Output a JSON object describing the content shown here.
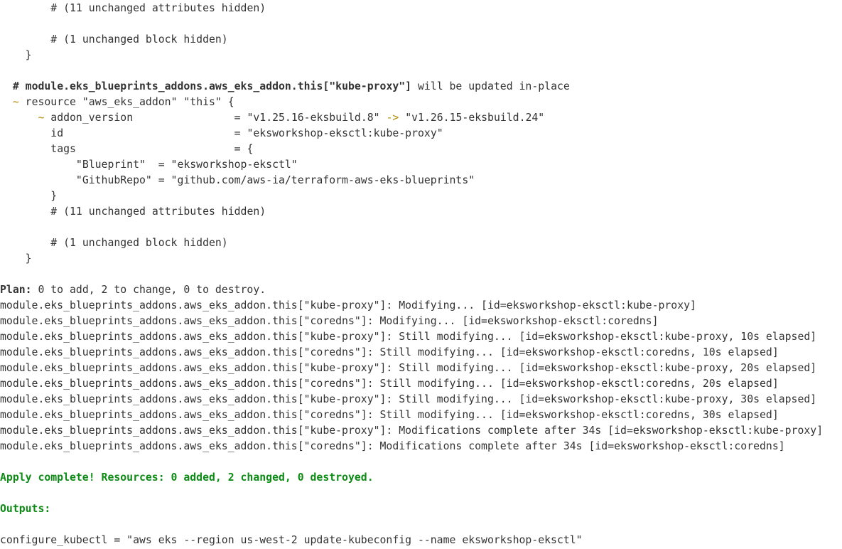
{
  "colors": {
    "background": "#ffffff",
    "text": "#333333",
    "success_green": "#0e8a16",
    "change_marker": "#b58900"
  },
  "terminal": {
    "block1": {
      "hidden_attrs": "# (11 unchanged attributes hidden)",
      "hidden_block": "# (1 unchanged block hidden)",
      "close_brace": "}"
    },
    "resource2": {
      "comment_prefix": "# ",
      "comment_address": "module.eks_blueprints_addons.aws_eks_addon.this[\"kube-proxy\"]",
      "comment_suffix": " will be updated in-place",
      "tilde": "~",
      "resource_decl": "resource \"aws_eks_addon\" \"this\" {",
      "addon_version": {
        "tilde": "~",
        "key": "addon_version",
        "eq": "= ",
        "old": "\"v1.25.16-eksbuild.8\"",
        "arrow": "->",
        "new": "\"v1.26.15-eksbuild.24\""
      },
      "id": {
        "key": "id",
        "eq": "= ",
        "value": "\"eksworkshop-eksctl:kube-proxy\""
      },
      "tags": {
        "key": "tags",
        "eq": "= ",
        "open": "{",
        "blueprint": "\"Blueprint\"  = \"eksworkshop-eksctl\"",
        "githubrepo": "\"GithubRepo\" = \"github.com/aws-ia/terraform-aws-eks-blueprints\"",
        "close": "}"
      },
      "hidden_attrs": "# (11 unchanged attributes hidden)",
      "hidden_block": "# (1 unchanged block hidden)",
      "close_brace": "}"
    },
    "plan": {
      "label": "Plan:",
      "text": " 0 to add, 2 to change, 0 to destroy."
    },
    "log_lines": [
      "module.eks_blueprints_addons.aws_eks_addon.this[\"kube-proxy\"]: Modifying... [id=eksworkshop-eksctl:kube-proxy]",
      "module.eks_blueprints_addons.aws_eks_addon.this[\"coredns\"]: Modifying... [id=eksworkshop-eksctl:coredns]",
      "module.eks_blueprints_addons.aws_eks_addon.this[\"kube-proxy\"]: Still modifying... [id=eksworkshop-eksctl:kube-proxy, 10s elapsed]",
      "module.eks_blueprints_addons.aws_eks_addon.this[\"coredns\"]: Still modifying... [id=eksworkshop-eksctl:coredns, 10s elapsed]",
      "module.eks_blueprints_addons.aws_eks_addon.this[\"kube-proxy\"]: Still modifying... [id=eksworkshop-eksctl:kube-proxy, 20s elapsed]",
      "module.eks_blueprints_addons.aws_eks_addon.this[\"coredns\"]: Still modifying... [id=eksworkshop-eksctl:coredns, 20s elapsed]",
      "module.eks_blueprints_addons.aws_eks_addon.this[\"kube-proxy\"]: Still modifying... [id=eksworkshop-eksctl:kube-proxy, 30s elapsed]",
      "module.eks_blueprints_addons.aws_eks_addon.this[\"coredns\"]: Still modifying... [id=eksworkshop-eksctl:coredns, 30s elapsed]",
      "module.eks_blueprints_addons.aws_eks_addon.this[\"kube-proxy\"]: Modifications complete after 34s [id=eksworkshop-eksctl:kube-proxy]",
      "module.eks_blueprints_addons.aws_eks_addon.this[\"coredns\"]: Modifications complete after 34s [id=eksworkshop-eksctl:coredns]"
    ],
    "apply_complete": "Apply complete! Resources: 0 added, 2 changed, 0 destroyed.",
    "outputs_label": "Outputs:",
    "output_kubectl": "configure_kubectl = \"aws eks --region us-west-2 update-kubeconfig --name eksworkshop-eksctl\""
  }
}
